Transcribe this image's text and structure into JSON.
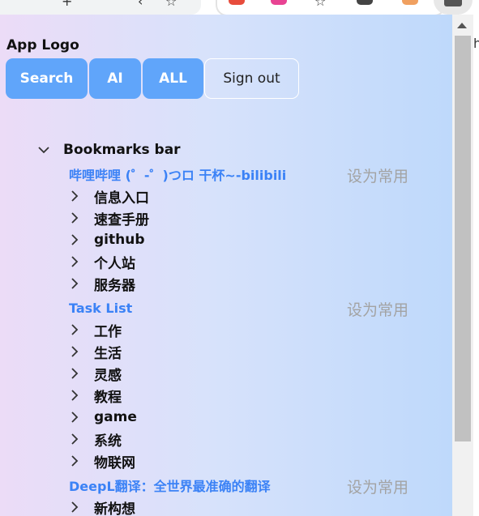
{
  "browser": {
    "glyph_left": "+",
    "glyph_star": "☆",
    "glyph_star2": "☆",
    "glyph_edge": "h"
  },
  "popup": {
    "logo": "App Logo",
    "buttons": {
      "search": "Search",
      "ai": "AI",
      "all": "ALL",
      "sign_out": "Sign out"
    },
    "tree": {
      "root": "Bookmarks bar",
      "pin_label": "设为常用",
      "items": [
        {
          "kind": "link",
          "label": "哔哩哔哩 (゜-゜)つロ 干杯~-bilibili"
        },
        {
          "kind": "folder",
          "label": "信息入口"
        },
        {
          "kind": "folder",
          "label": "速查手册"
        },
        {
          "kind": "folder",
          "label": "github"
        },
        {
          "kind": "folder",
          "label": "个人站"
        },
        {
          "kind": "folder",
          "label": "服务器"
        },
        {
          "kind": "link",
          "label": "Task List"
        },
        {
          "kind": "folder",
          "label": "工作"
        },
        {
          "kind": "folder",
          "label": "生活"
        },
        {
          "kind": "folder",
          "label": "灵感"
        },
        {
          "kind": "folder",
          "label": "教程"
        },
        {
          "kind": "folder",
          "label": "game"
        },
        {
          "kind": "folder",
          "label": "系统"
        },
        {
          "kind": "folder",
          "label": "物联网"
        },
        {
          "kind": "link",
          "label": "DeepL翻译：全世界最准确的翻译"
        },
        {
          "kind": "folder",
          "label": "新构想"
        }
      ]
    }
  },
  "colors": {
    "accent": "#60a5fa",
    "link": "#3b82f6",
    "pin": "#a3a3a3"
  }
}
